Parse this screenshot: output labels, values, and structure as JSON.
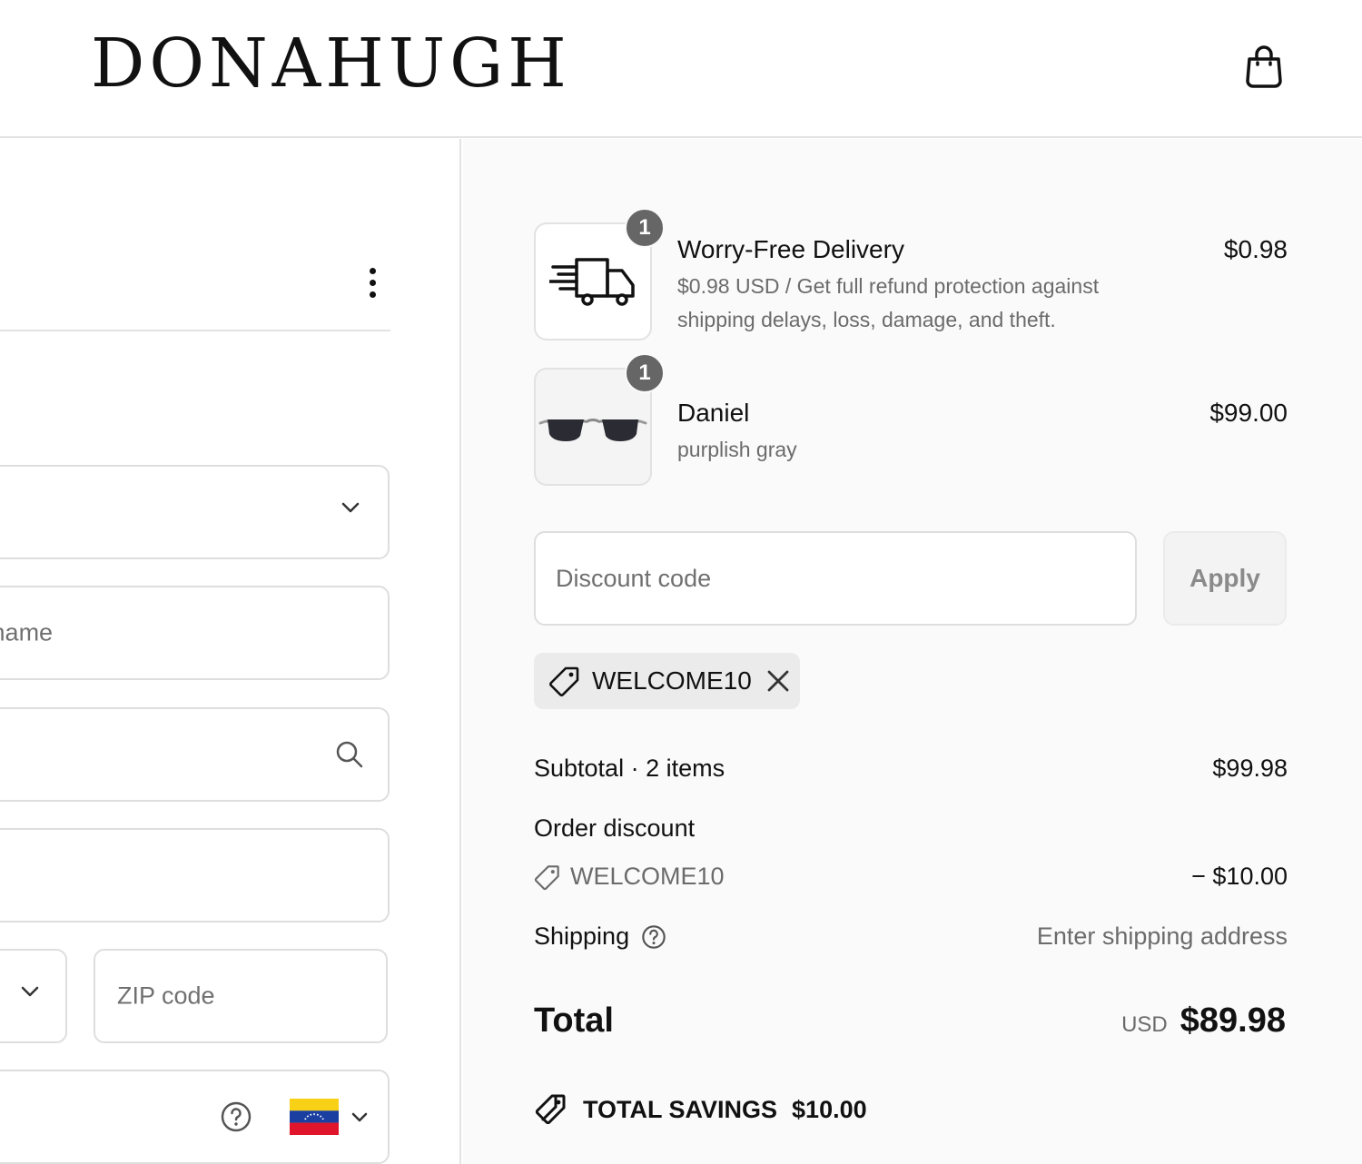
{
  "header": {
    "logo": "DONAHUGH",
    "cart_icon": "shopping-bag-icon"
  },
  "form": {
    "menu_icon": "kebab-menu-icon",
    "last_name_placeholder": "Last name",
    "zip_placeholder": "ZIP code",
    "phone_country_flag": "venezuela-flag"
  },
  "summary": {
    "items": [
      {
        "name": "Worry-Free Delivery",
        "description": "$0.98 USD / Get full refund protection against shipping delays, loss, damage, and theft.",
        "price": "$0.98",
        "quantity": "1",
        "icon": "delivery-truck-icon"
      },
      {
        "name": "Daniel",
        "description": "purplish gray",
        "price": "$99.00",
        "quantity": "1",
        "icon": "sunglasses-image"
      }
    ],
    "discount": {
      "placeholder": "Discount code",
      "apply_label": "Apply",
      "applied_code": "WELCOME10"
    },
    "subtotal_label": "Subtotal · 2 items",
    "subtotal_value": "$99.98",
    "order_discount_label": "Order discount",
    "order_discount_code": "WELCOME10",
    "order_discount_value": "− $10.00",
    "shipping_label": "Shipping",
    "shipping_value": "Enter shipping address",
    "total_label": "Total",
    "total_currency": "USD",
    "total_value": "$89.98",
    "savings_label": "TOTAL SAVINGS",
    "savings_value": "$10.00"
  },
  "colors": {
    "summary_bg": "#fafafa",
    "badge": "#666666",
    "border": "#dedede"
  }
}
